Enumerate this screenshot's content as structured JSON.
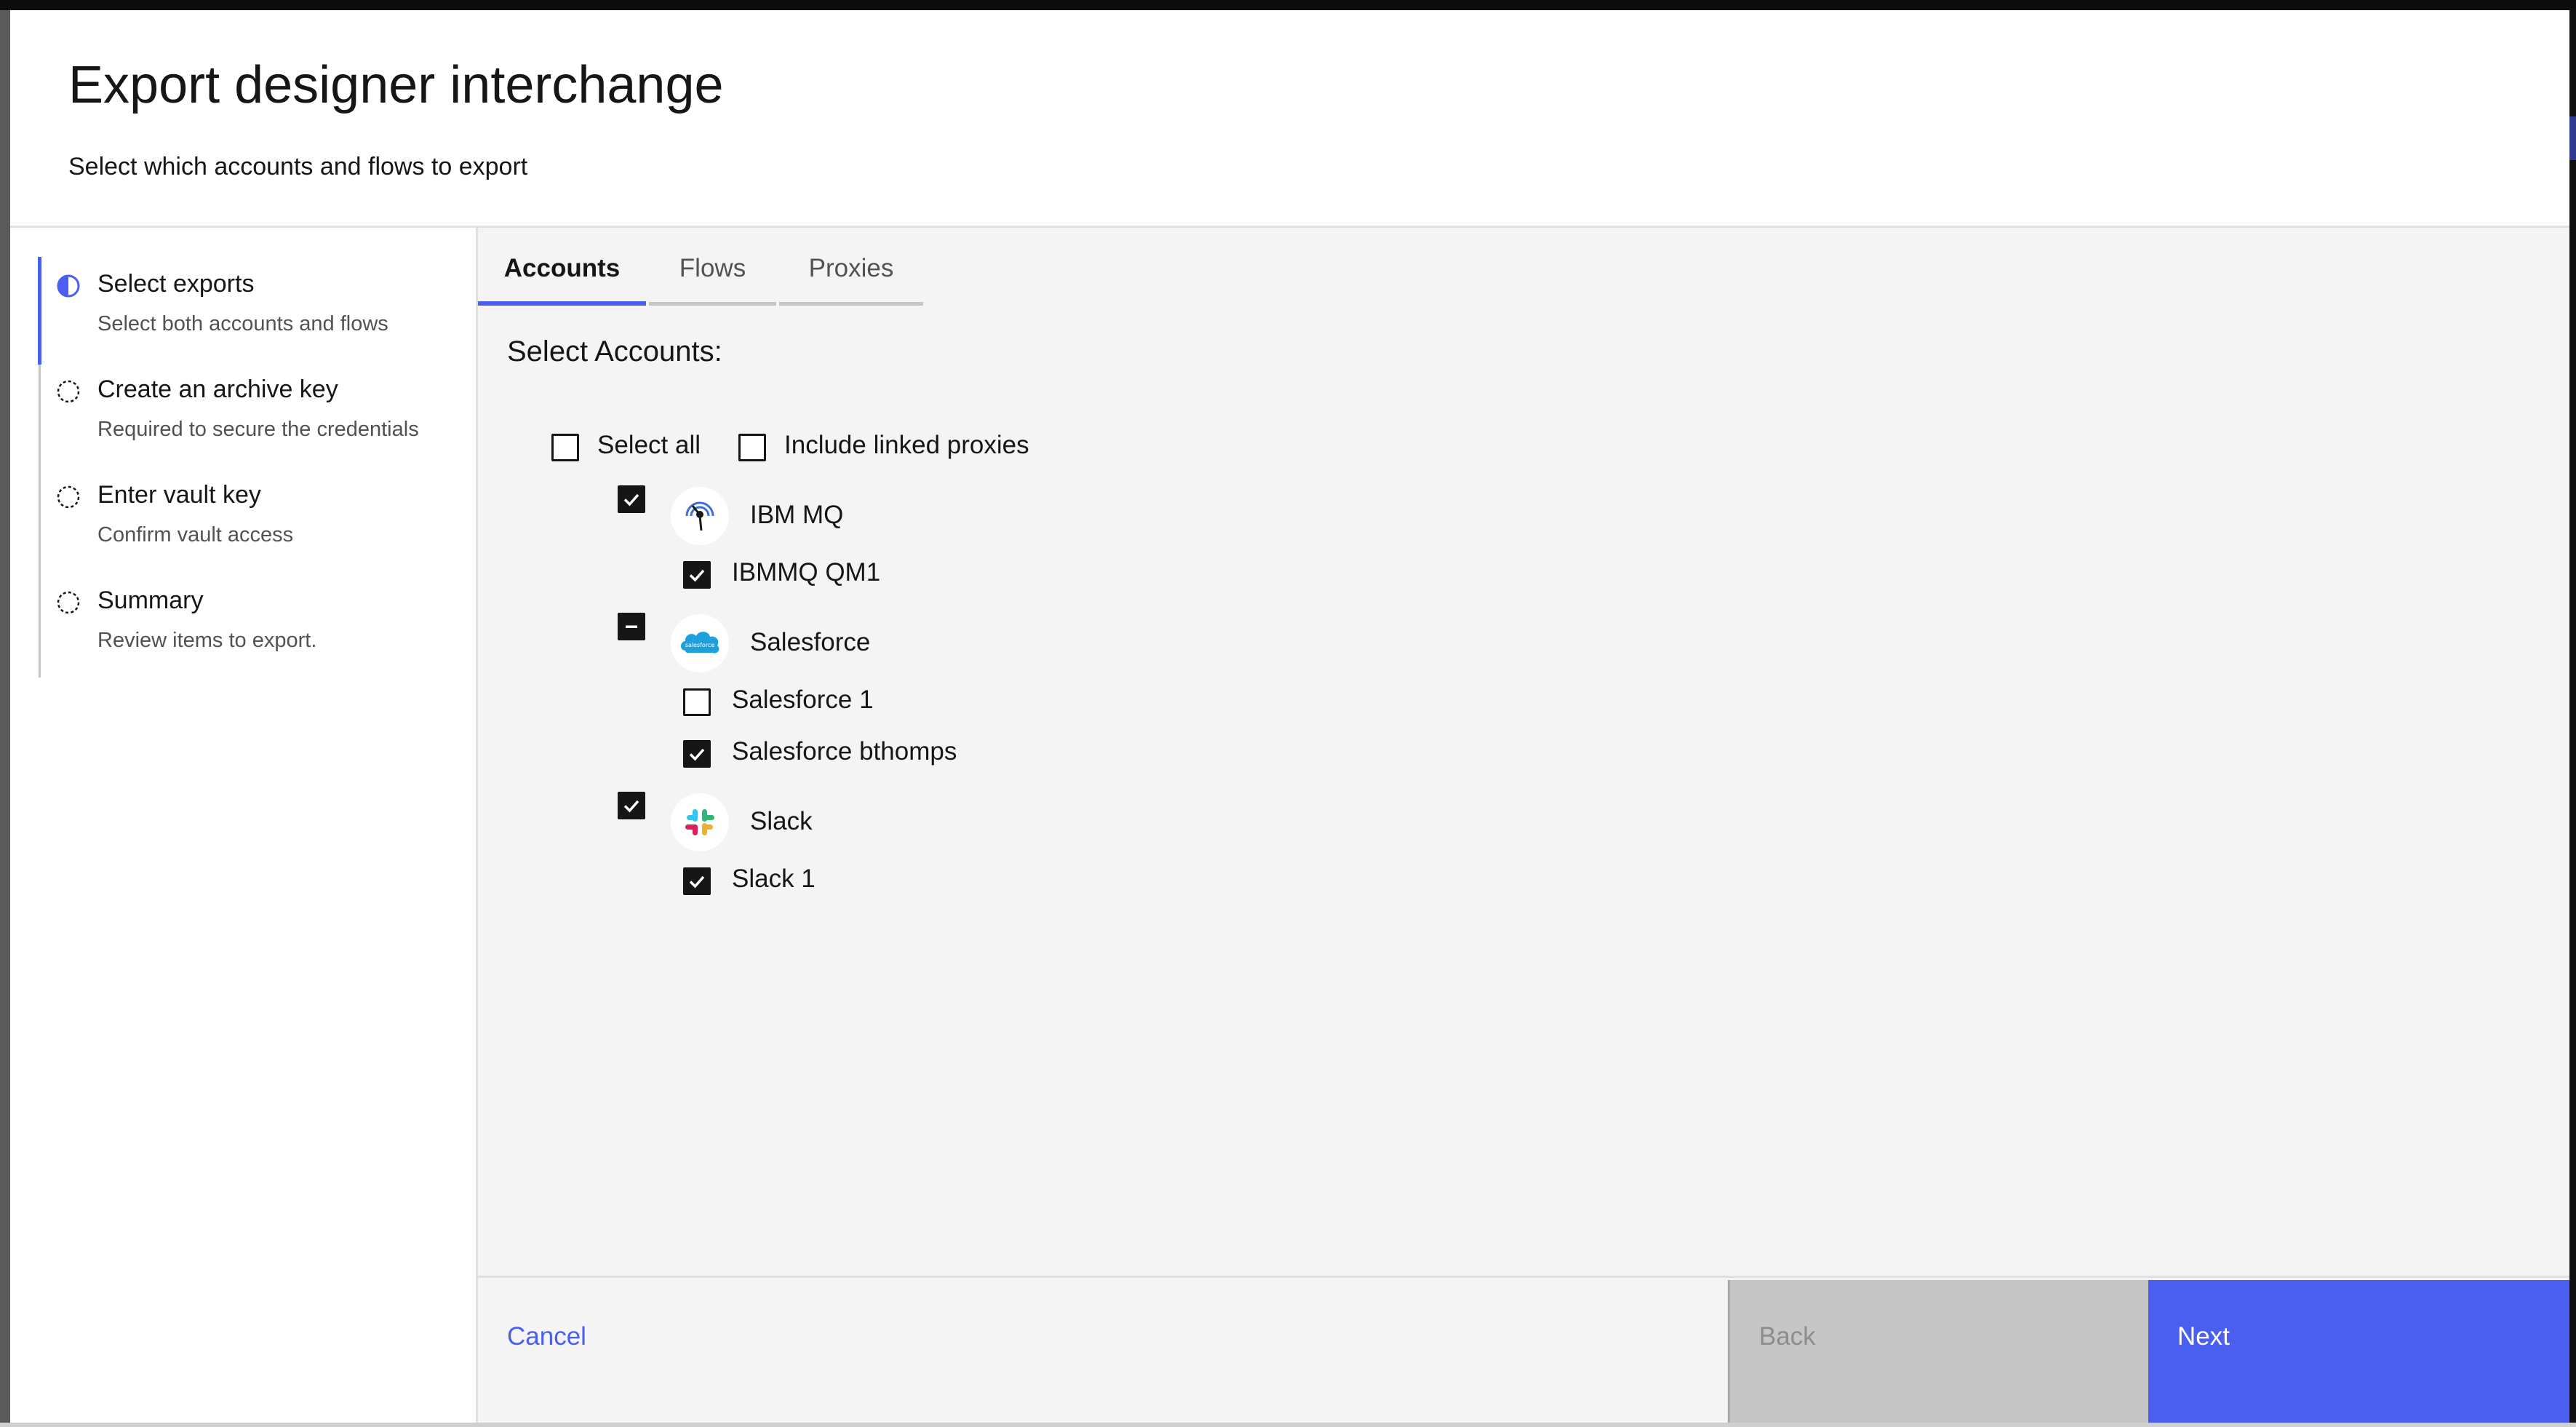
{
  "dialog": {
    "title": "Export designer interchange",
    "subtitle": "Select which accounts and flows to export"
  },
  "steps": [
    {
      "label": "Select exports",
      "description": "Select both accounts and flows",
      "state": "current"
    },
    {
      "label": "Create an archive key",
      "description": "Required to secure the credentials",
      "state": "incomplete"
    },
    {
      "label": "Enter vault key",
      "description": "Confirm vault access",
      "state": "incomplete"
    },
    {
      "label": "Summary",
      "description": "Review items to export.",
      "state": "incomplete"
    }
  ],
  "tabs": [
    {
      "label": "Accounts",
      "selected": true
    },
    {
      "label": "Flows",
      "selected": false
    },
    {
      "label": "Proxies",
      "selected": false
    }
  ],
  "accounts": {
    "heading": "Select Accounts:",
    "select_all": {
      "label": "Select all",
      "checked": false
    },
    "include_linked_proxies": {
      "label": "Include linked proxies",
      "checked": false
    },
    "groups": [
      {
        "name": "IBM MQ",
        "logo": "ibm-mq-logo-icon",
        "state": "checked",
        "items": [
          {
            "label": "IBMMQ QM1",
            "checked": true
          }
        ]
      },
      {
        "name": "Salesforce",
        "logo": "salesforce-logo-icon",
        "logo_text": "salesforce",
        "state": "indeterminate",
        "items": [
          {
            "label": "Salesforce 1",
            "checked": false
          },
          {
            "label": "Salesforce bthomps",
            "checked": true
          }
        ]
      },
      {
        "name": "Slack",
        "logo": "slack-logo-icon",
        "state": "checked",
        "items": [
          {
            "label": "Slack 1",
            "checked": true
          }
        ]
      }
    ]
  },
  "footer": {
    "cancel_label": "Cancel",
    "back_label": "Back",
    "next_label": "Next",
    "back_disabled": true
  },
  "colors": {
    "accent": "#4a5ff0",
    "checkbox_fill": "#161616",
    "disabled_button": "#c6c6c6",
    "background": "#f4f4f4"
  }
}
